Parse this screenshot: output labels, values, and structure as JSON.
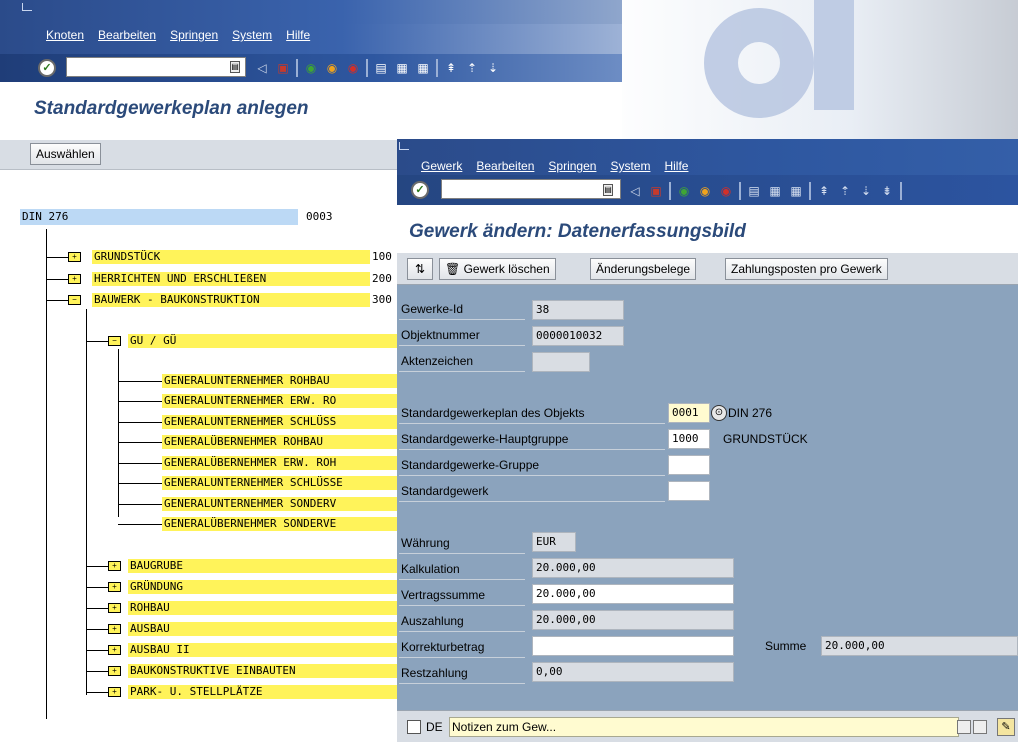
{
  "win1": {
    "menu": [
      "Knoten",
      "Bearbeiten",
      "Springen",
      "System",
      "Hilfe"
    ],
    "title": "Standardgewerkeplan anlegen",
    "select_button": "Auswählen",
    "root_label": "DIN 276",
    "root_number": "0003",
    "groups": [
      {
        "label": "GRUNDSTÜCK",
        "code": "100"
      },
      {
        "label": "HERRICHTEN UND ERSCHLIEßEN",
        "code": "200"
      },
      {
        "label": "BAUWERK - BAUKONSTRUKTION",
        "code": "300"
      }
    ],
    "subgroup": "GU / GÜ",
    "leaves": [
      "GENERALUNTERNEHMER ROHBAU",
      "GENERALUNTERNEHMER ERW. RO",
      "GENERALUNTERNEHMER SCHLÜSS",
      "GENERALÜBERNEHMER ROHBAU",
      "GENERALÜBERNEHMER ERW. ROH",
      "GENERALUNTERNEHMER SCHLÜSSE",
      "GENERALUNTERNEHMER SONDERV",
      "GENERALÜBERNEHMER SONDERVE"
    ],
    "subnodes": [
      "BAUGRUBE",
      "GRÜNDUNG",
      "ROHBAU",
      "AUSBAU",
      "AUSBAU II",
      "BAUKONSTRUKTIVE EINBAUTEN",
      "PARK- U. STELLPLÄTZE"
    ]
  },
  "win2": {
    "menu": [
      "Gewerk",
      "Bearbeiten",
      "Springen",
      "System",
      "Hilfe"
    ],
    "title": "Gewerk ändern: Datenerfassungsbild",
    "buttons": {
      "delete": "Gewerk löschen",
      "changes": "Änderungsbelege",
      "payments": "Zahlungsposten pro Gewerk"
    },
    "fields": {
      "gewerke_id": {
        "label": "Gewerke-Id",
        "value": "38"
      },
      "objektnummer": {
        "label": "Objektnummer",
        "value": "0000010032"
      },
      "aktenzeichen": {
        "label": "Aktenzeichen",
        "value": ""
      },
      "plan": {
        "label": "Standardgewerkeplan des Objekts",
        "value": "0001",
        "text": "DIN 276"
      },
      "hauptgruppe": {
        "label": "Standardgewerke-Hauptgruppe",
        "value": "1000",
        "text": "GRUNDSTÜCK"
      },
      "gruppe": {
        "label": "Standardgewerke-Gruppe",
        "value": ""
      },
      "gewerk": {
        "label": "Standardgewerk",
        "value": ""
      },
      "waehrung": {
        "label": "Währung",
        "value": "EUR"
      },
      "kalkulation": {
        "label": "Kalkulation",
        "value": "20.000,00"
      },
      "vertragssumme": {
        "label": "Vertragssumme",
        "value": "20.000,00"
      },
      "auszahlung": {
        "label": "Auszahlung",
        "value": "20.000,00"
      },
      "korrekturbetrag": {
        "label": "Korrekturbetrag",
        "value": ""
      },
      "restzahlung": {
        "label": "Restzahlung",
        "value": "0,00"
      },
      "summe": {
        "label": "Summe",
        "value": "20.000,00"
      }
    },
    "status": {
      "language": "DE",
      "notes": "Notizen zum Gew..."
    }
  }
}
